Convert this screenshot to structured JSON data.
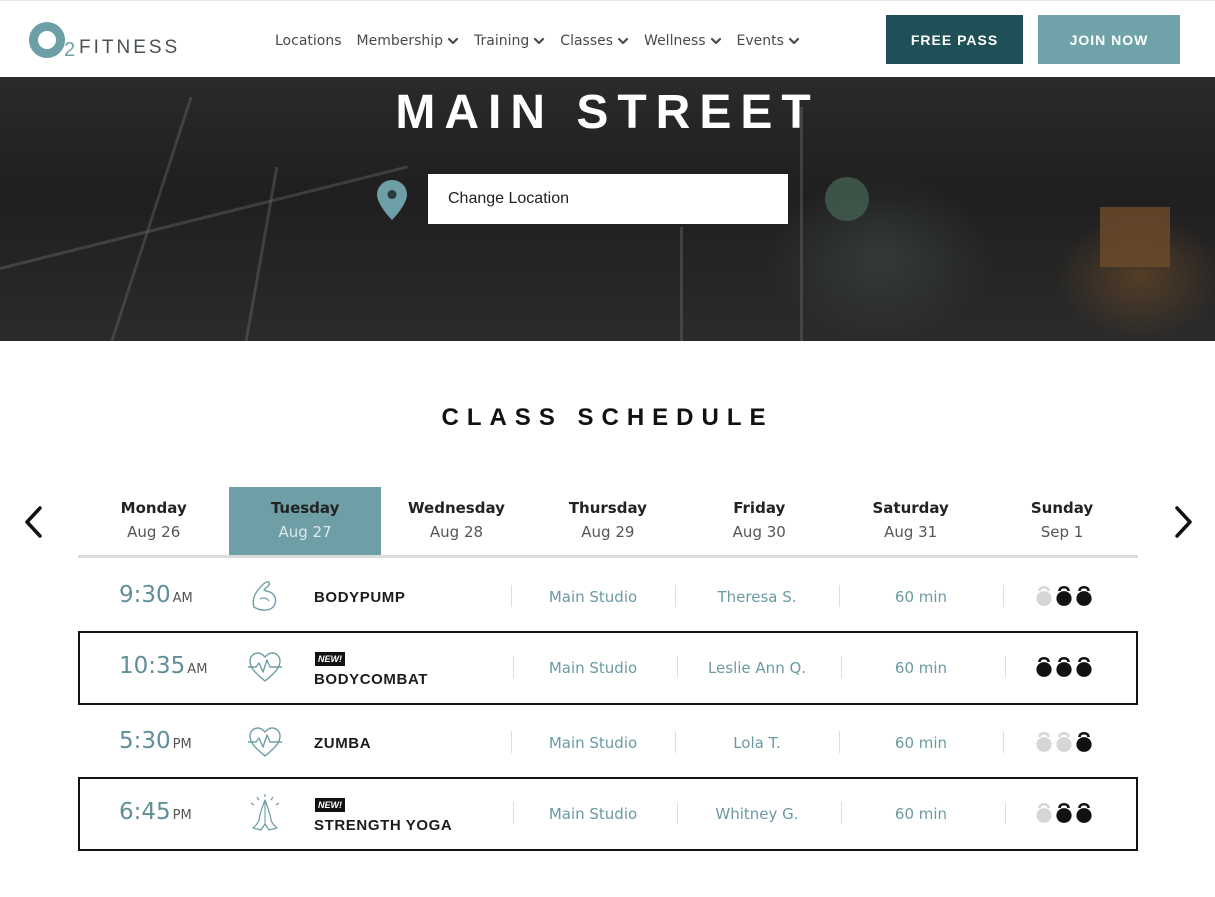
{
  "brand": {
    "logo_two": "2",
    "logo_text": "FITNESS"
  },
  "colors": {
    "accent": "#6e9ea6",
    "dark_teal": "#1f5057",
    "light_teal": "#70a2a9",
    "kettlebell_on": "#111111",
    "kettlebell_off": "#d6d6d6"
  },
  "nav": [
    {
      "label": "Locations",
      "dropdown": false
    },
    {
      "label": "Membership",
      "dropdown": true
    },
    {
      "label": "Training",
      "dropdown": true
    },
    {
      "label": "Classes",
      "dropdown": true
    },
    {
      "label": "Wellness",
      "dropdown": true
    },
    {
      "label": "Events",
      "dropdown": true
    }
  ],
  "header": {
    "free_pass_label": "FREE PASS",
    "join_now_label": "JOIN NOW"
  },
  "hero": {
    "title": "MAIN STREET",
    "location_input_value": "Change Location"
  },
  "schedule": {
    "title": "CLASS SCHEDULE",
    "days": [
      {
        "name": "Monday",
        "date": "Aug 26",
        "active": false
      },
      {
        "name": "Tuesday",
        "date": "Aug 27",
        "active": true
      },
      {
        "name": "Wednesday",
        "date": "Aug 28",
        "active": false
      },
      {
        "name": "Thursday",
        "date": "Aug 29",
        "active": false
      },
      {
        "name": "Friday",
        "date": "Aug 30",
        "active": false
      },
      {
        "name": "Saturday",
        "date": "Aug 31",
        "active": false
      },
      {
        "name": "Sunday",
        "date": "Sep 1",
        "active": false
      }
    ],
    "classes": [
      {
        "time": "9:30",
        "ampm": "AM",
        "icon": "flexed-arm-icon",
        "name": "BODYPUMP",
        "is_new": false,
        "studio": "Main Studio",
        "instructor": "Theresa S.",
        "duration": "60 min",
        "intensity": 2,
        "intensity_max": 3,
        "highlighted": false
      },
      {
        "time": "10:35",
        "ampm": "AM",
        "icon": "heartbeat-icon",
        "name": "BODYCOMBAT",
        "is_new": true,
        "new_label": "NEW!",
        "studio": "Main Studio",
        "instructor": "Leslie Ann Q.",
        "duration": "60 min",
        "intensity": 3,
        "intensity_max": 3,
        "highlighted": true
      },
      {
        "time": "5:30",
        "ampm": "PM",
        "icon": "heartbeat-icon",
        "name": "ZUMBA",
        "is_new": false,
        "studio": "Main Studio",
        "instructor": "Lola T.",
        "duration": "60 min",
        "intensity": 1,
        "intensity_max": 3,
        "highlighted": false
      },
      {
        "time": "6:45",
        "ampm": "PM",
        "icon": "praying-hands-icon",
        "name": "STRENGTH YOGA",
        "is_new": true,
        "new_label": "NEW!",
        "studio": "Main Studio",
        "instructor": "Whitney G.",
        "duration": "60 min",
        "intensity": 2,
        "intensity_max": 3,
        "highlighted": true
      }
    ]
  }
}
